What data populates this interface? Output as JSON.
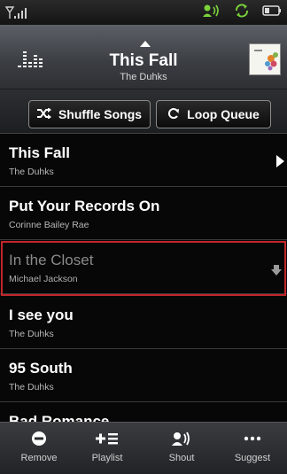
{
  "now_playing": {
    "title": "This Fall",
    "artist": "The Duhks"
  },
  "controls": {
    "shuffle_label": "Shuffle Songs",
    "loop_label": "Loop Queue"
  },
  "queue": [
    {
      "title": "This Fall",
      "artist": "The Duhks",
      "state": "playing"
    },
    {
      "title": "Put Your Records On",
      "artist": "Corinne Bailey Rae",
      "state": "normal"
    },
    {
      "title": "In the Closet",
      "artist": "Michael Jackson",
      "state": "selected"
    },
    {
      "title": "I see you",
      "artist": "The Duhks",
      "state": "normal"
    },
    {
      "title": "95 South",
      "artist": "The Duhks",
      "state": "normal"
    },
    {
      "title": "Bad Romance",
      "artist": "",
      "state": "normal"
    }
  ],
  "toolbar": {
    "remove_label": "Remove",
    "playlist_label": "Playlist",
    "shout_label": "Shout",
    "suggest_label": "Suggest"
  },
  "colors": {
    "accent_green": "#7bd23b",
    "selection_red": "#c0262b"
  },
  "icons": {
    "status": [
      "signal-icon",
      "speaker-icon",
      "sync-icon",
      "battery-icon"
    ],
    "toolbar": [
      "minus-circle-icon",
      "add-to-playlist-icon",
      "shout-icon",
      "more-icon"
    ]
  }
}
